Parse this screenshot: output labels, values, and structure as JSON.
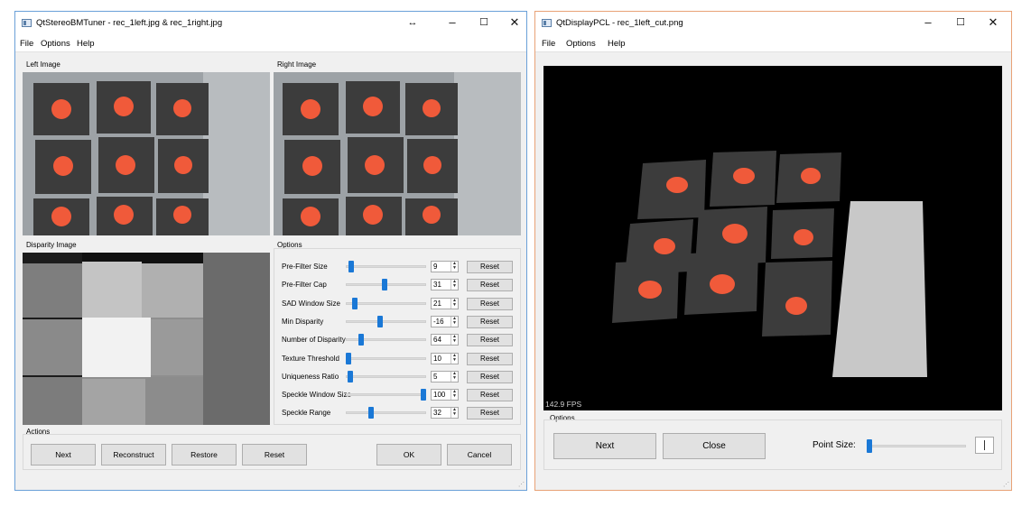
{
  "tuner": {
    "title": "QtStereoBMTuner - rec_1left.jpg & rec_1right.jpg",
    "menu": [
      "File",
      "Options",
      "Help"
    ],
    "left_image_label": "Left Image",
    "right_image_label": "Right Image",
    "disparity_label": "Disparity Image",
    "options_label": "Options",
    "actions_label": "Actions",
    "options": [
      {
        "label": "Pre-Filter Size",
        "value": "9",
        "level": 0.04,
        "reset": "Reset"
      },
      {
        "label": "Pre-Filter Cap",
        "value": "31",
        "level": 0.48,
        "reset": "Reset"
      },
      {
        "label": "SAD Window Size",
        "value": "21",
        "level": 0.08,
        "reset": "Reset"
      },
      {
        "label": "Min Disparity",
        "value": "-16",
        "level": 0.42,
        "reset": "Reset"
      },
      {
        "label": "Number of Disparity",
        "value": "64",
        "level": 0.17,
        "reset": "Reset"
      },
      {
        "label": "Texture Threshold",
        "value": "10",
        "level": 0.0,
        "reset": "Reset"
      },
      {
        "label": "Uniqueness Ratio",
        "value": "5",
        "level": 0.03,
        "reset": "Reset"
      },
      {
        "label": "Speckle Window Size",
        "value": "100",
        "level": 1.0,
        "reset": "Reset"
      },
      {
        "label": "Speckle Range",
        "value": "32",
        "level": 0.3,
        "reset": "Reset"
      }
    ],
    "actions": {
      "next": "Next",
      "reconstruct": "Reconstruct",
      "restore": "Restore",
      "reset": "Reset",
      "ok": "OK",
      "cancel": "Cancel"
    }
  },
  "display": {
    "title": "QtDisplayPCL - rec_1left_cut.png",
    "menu": [
      "File",
      "Options",
      "Help"
    ],
    "fps": "142.9 FPS",
    "options_label": "Options",
    "next": "Next",
    "close": "Close",
    "point_size_label": "Point Size:",
    "point_size_level": 0.0
  },
  "colors": {
    "accent": "#1a78d6",
    "marker": "#f05a3a",
    "tile": "#3c3c3c",
    "tuner_border": "#6aa0d8",
    "display_border": "#e8a276"
  }
}
